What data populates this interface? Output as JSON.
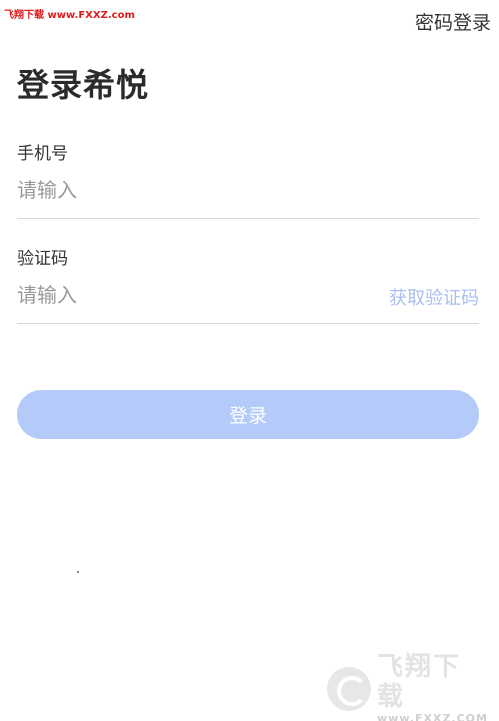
{
  "watermark": {
    "top_text": "飞翔下载 www.FXXZ.com",
    "logo_main": "飞翔下载",
    "logo_sub": "www.FXXZ.COM"
  },
  "header": {
    "password_login": "密码登录"
  },
  "title": "登录希悦",
  "phone_field": {
    "label": "手机号",
    "placeholder": "请输入",
    "value": ""
  },
  "code_field": {
    "label": "验证码",
    "placeholder": "请输入",
    "value": "",
    "get_code": "获取验证码"
  },
  "login_button": "登录",
  "colors": {
    "accent_disabled": "#b4cbf9",
    "link_disabled": "#a9bff0",
    "title": "#2b2b2b"
  }
}
